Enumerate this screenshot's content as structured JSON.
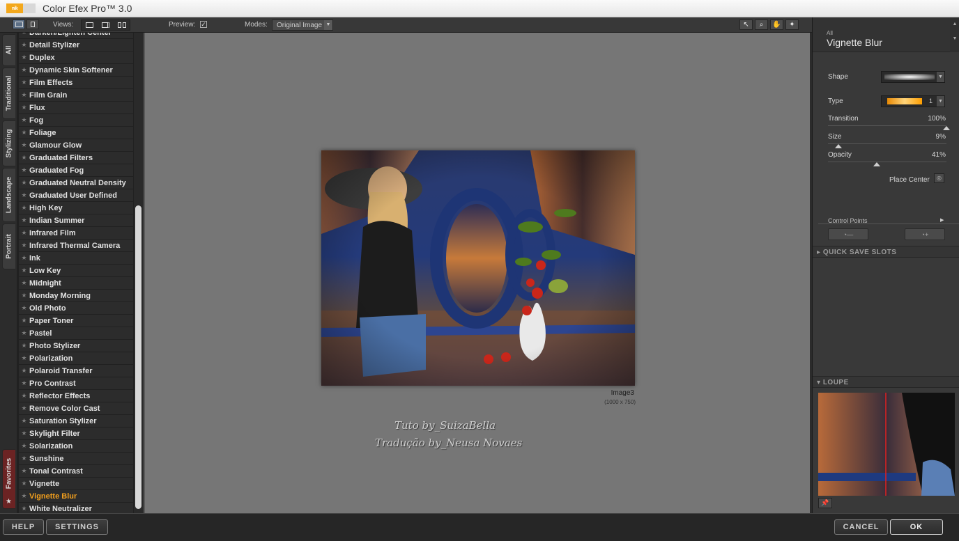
{
  "window": {
    "title": "Color Efex Pro™ 3.0",
    "logo_text": "nik"
  },
  "toolbar": {
    "views_label": "Views:",
    "preview_label": "Preview:",
    "preview_checked": "✓",
    "modes_label": "Modes:",
    "modes_value": "Original Image"
  },
  "category_tabs": [
    "All",
    "Traditional",
    "Stylizing",
    "Landscape",
    "Portrait",
    "Favorites"
  ],
  "filters": [
    "Darken/Lighten Center",
    "Detail Stylizer",
    "Duplex",
    "Dynamic Skin Softener",
    "Film Effects",
    "Film Grain",
    "Flux",
    "Fog",
    "Foliage",
    "Glamour Glow",
    "Graduated Filters",
    "Graduated Fog",
    "Graduated Neutral Density",
    "Graduated User Defined",
    "High Key",
    "Indian Summer",
    "Infrared Film",
    "Infrared Thermal Camera",
    "Ink",
    "Low Key",
    "Midnight",
    "Monday Morning",
    "Old Photo",
    "Paper Toner",
    "Pastel",
    "Photo Stylizer",
    "Polarization",
    "Polaroid Transfer",
    "Pro Contrast",
    "Reflector Effects",
    "Remove Color Cast",
    "Saturation Stylizer",
    "Skylight Filter",
    "Solarization",
    "Sunshine",
    "Tonal Contrast",
    "Vignette",
    "Vignette Blur",
    "White Neutralizer"
  ],
  "selected_filter_index": 37,
  "preview": {
    "image_name": "Image3",
    "image_size": "(1000 x 750)",
    "watermark_line1": "Tuto by_SuizaBella",
    "watermark_line2": "Tradução by_Neusa Novaes"
  },
  "panel": {
    "category": "All",
    "filter_name": "Vignette Blur",
    "shape_label": "Shape",
    "type_label": "Type",
    "type_value": "1",
    "transition_label": "Transition",
    "transition_value": "100%",
    "transition_level": 100,
    "size_label": "Size",
    "size_value": "9%",
    "size_level": 9,
    "opacity_label": "Opacity",
    "opacity_value": "41%",
    "opacity_level": 41,
    "place_center_label": "Place Center",
    "control_points_label": "Control Points",
    "quick_save_label": "QUICK SAVE SLOTS",
    "loupe_label": "LOUPE"
  },
  "buttons": {
    "help": "HELP",
    "settings": "SETTINGS",
    "cancel": "CANCEL",
    "ok": "OK"
  },
  "colors": {
    "accent_selected": "#f4a01d",
    "favorites_tab": "#6b2323",
    "canvas": "#767676"
  }
}
